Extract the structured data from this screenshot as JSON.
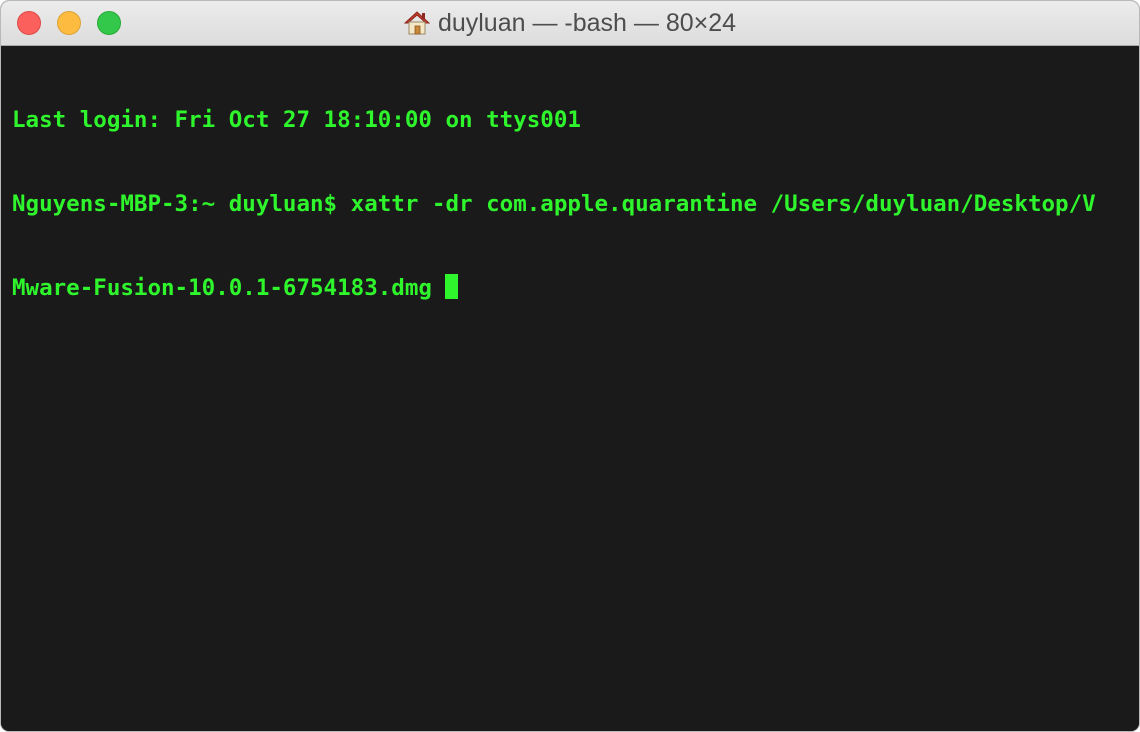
{
  "window": {
    "title": "duyluan — -bash — 80×24",
    "title_icon": "home-icon",
    "controls": [
      "close",
      "minimize",
      "zoom"
    ]
  },
  "terminal": {
    "lines": [
      "Last login: Fri Oct 27 18:10:00 on ttys001",
      "Nguyens-MBP-3:~ duyluan$ xattr -dr com.apple.quarantine /Users/duyluan/Desktop/V",
      "Mware-Fusion-10.0.1-6754183.dmg "
    ]
  },
  "colors": {
    "background": "#1a1a1a",
    "foreground": "#2ff52c"
  }
}
